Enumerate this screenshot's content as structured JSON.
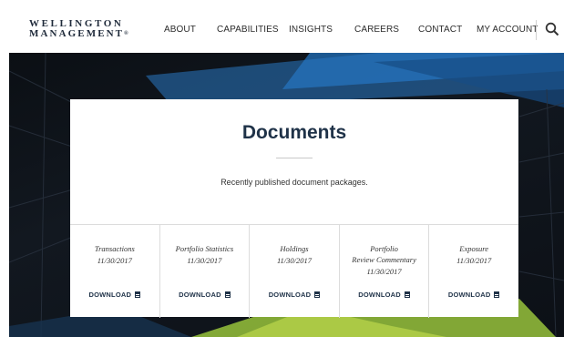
{
  "brand": {
    "line1": "WELLINGTON",
    "line2": "MANAGEMENT",
    "mark": "®"
  },
  "nav": {
    "items": [
      "ABOUT",
      "CAPABILITIES",
      "INSIGHTS",
      "CAREERS",
      "CONTACT",
      "MY ACCOUNT"
    ]
  },
  "search": {
    "icon": "search-icon"
  },
  "card": {
    "title": "Documents",
    "subtitle": "Recently published document packages.",
    "docs": [
      {
        "name_lines": [
          "Transactions"
        ],
        "date": "11/30/2017",
        "download": "DOWNLOAD"
      },
      {
        "name_lines": [
          "Portfolio Statistics"
        ],
        "date": "11/30/2017",
        "download": "DOWNLOAD"
      },
      {
        "name_lines": [
          "Holdings"
        ],
        "date": "11/30/2017",
        "download": "DOWNLOAD"
      },
      {
        "name_lines": [
          "Portfolio",
          "Review Commentary"
        ],
        "date": "11/30/2017",
        "download": "DOWNLOAD"
      },
      {
        "name_lines": [
          "Exposure"
        ],
        "date": "11/30/2017",
        "download": "DOWNLOAD"
      }
    ]
  },
  "colors": {
    "navy": "#1f3248",
    "hero_dark": "#0b0f14",
    "accent_blue": "#1f6fb8",
    "accent_green": "#8fb83a"
  }
}
